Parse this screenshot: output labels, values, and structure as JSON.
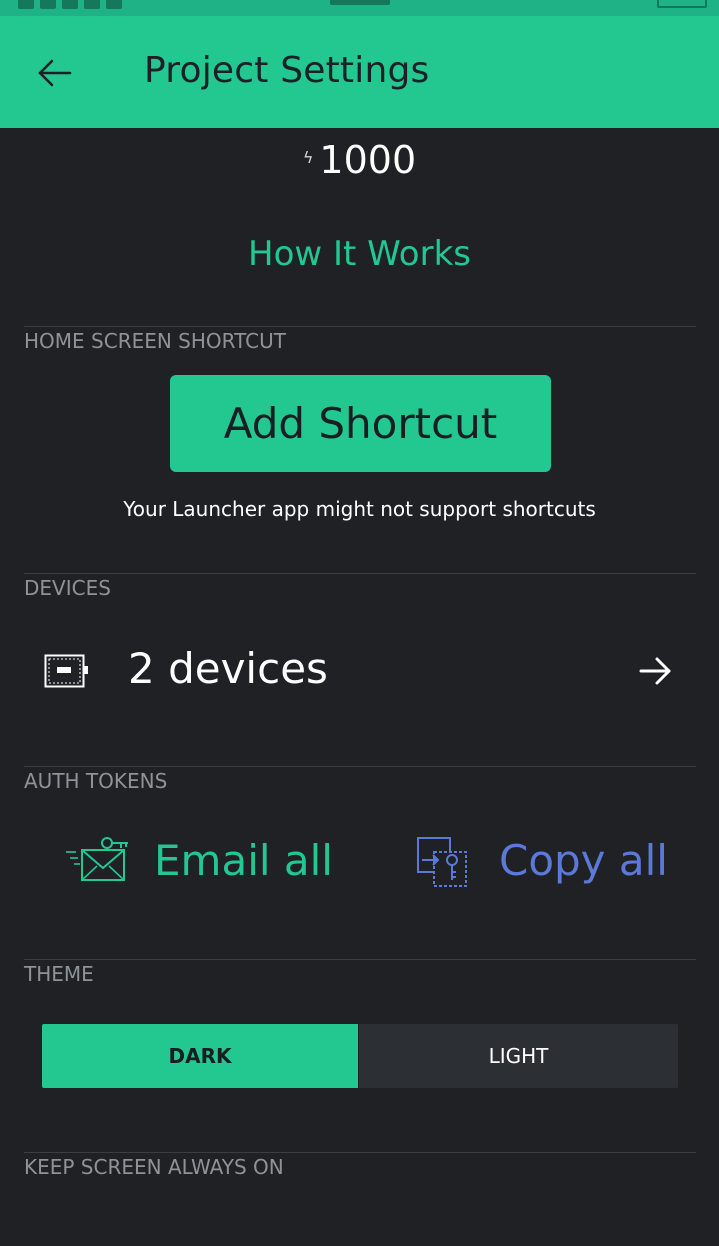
{
  "header": {
    "title": "Project Settings",
    "back_icon": "arrow-left-icon"
  },
  "energy": {
    "icon": "lightning-bolt-icon",
    "value": "1000"
  },
  "how_it_works": "How It Works",
  "sections": {
    "home_screen_shortcut": {
      "label": "HOME SCREEN SHORTCUT",
      "button_label": "Add Shortcut",
      "note": "Your Launcher app might not support shortcuts"
    },
    "devices": {
      "label": "DEVICES",
      "icon": "device-board-icon",
      "text": "2 devices",
      "arrow_icon": "arrow-right-icon"
    },
    "auth_tokens": {
      "label": "AUTH TOKENS",
      "email_label": "Email all",
      "email_icon": "email-key-icon",
      "copy_label": "Copy all",
      "copy_icon": "copy-key-icon"
    },
    "theme": {
      "label": "THEME",
      "options": [
        "DARK",
        "LIGHT"
      ],
      "selected": "DARK"
    },
    "keep_screen_on": {
      "label": "KEEP SCREEN ALWAYS ON"
    }
  },
  "colors": {
    "accent": "#23c890",
    "background": "#1f2125",
    "copy_blue": "#5b79d9",
    "divider": "#3a3d43",
    "section_label": "#8e9399"
  }
}
